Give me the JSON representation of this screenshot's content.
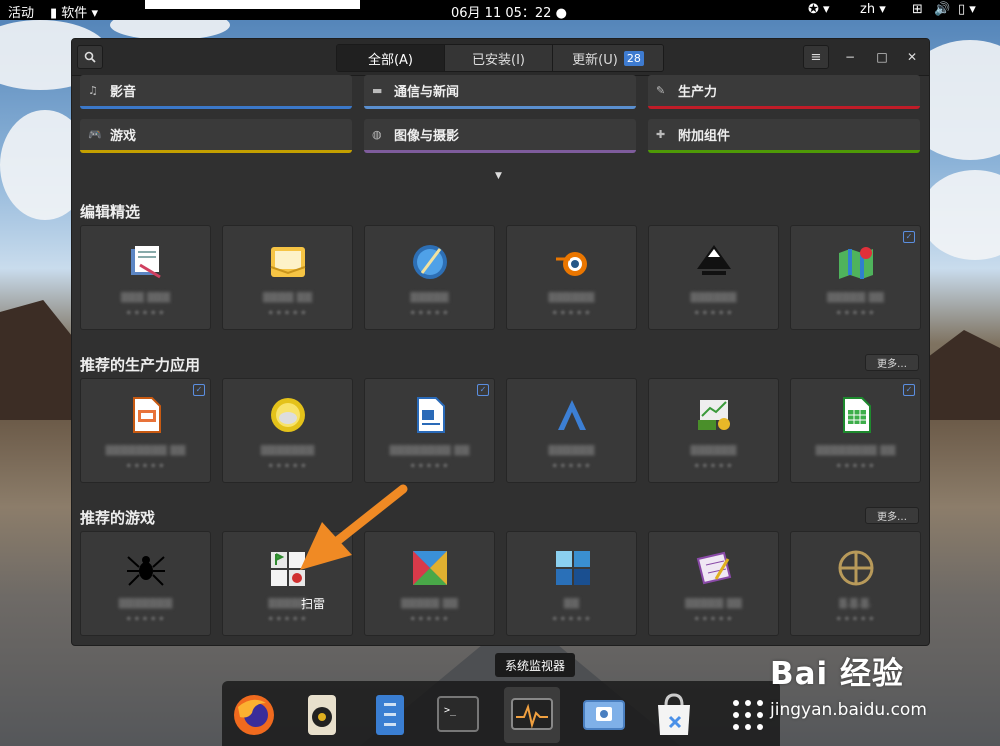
{
  "topbar": {
    "activities": "活动",
    "app_menu": "软件",
    "clock": "06月 11  05：22",
    "lang": "zh"
  },
  "header": {
    "tabs": [
      {
        "label": "全部(A)",
        "active": true
      },
      {
        "label": "已安装(I)",
        "active": false
      },
      {
        "label": "更新(U)",
        "active": false,
        "badge": "28"
      }
    ]
  },
  "categories": [
    {
      "label": "影音",
      "color": "#3b78c9",
      "icon": "music-note-icon"
    },
    {
      "label": "通信与新闻",
      "color": "#5a8fcf",
      "icon": "chat-bubble-icon"
    },
    {
      "label": "生产力",
      "color": "#c01c28",
      "icon": "edit-icon"
    },
    {
      "label": "游戏",
      "color": "#c4a000",
      "icon": "gamepad-icon"
    },
    {
      "label": "图像与摄影",
      "color": "#7e5c9c",
      "icon": "camera-aperture-icon"
    },
    {
      "label": "附加组件",
      "color": "#4e9a06",
      "icon": "puzzle-icon"
    }
  ],
  "sections": {
    "editors_choice": {
      "title": "编辑精选"
    },
    "productivity": {
      "title": "推荐的生产力应用",
      "more": "更多…"
    },
    "games": {
      "title": "推荐的游戏",
      "more": "更多…"
    }
  },
  "annotation_text": "扫雷",
  "tooltip": "系统监视器",
  "watermark": {
    "logo": "Bai 经验",
    "url": "jingyan.baidu.com"
  },
  "colors": {
    "accent": "#3e7bd0",
    "arrow": "#f08a24",
    "window_bg": "#303030"
  }
}
